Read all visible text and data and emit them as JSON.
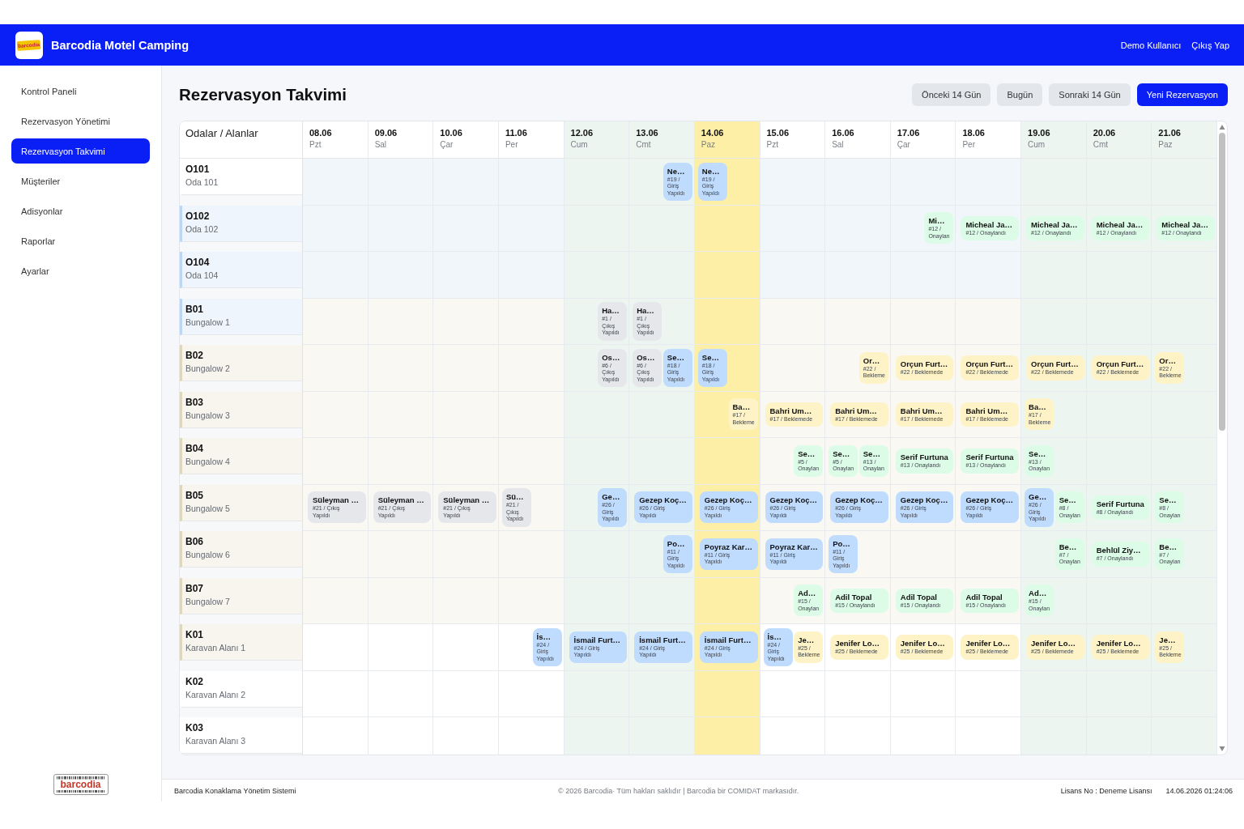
{
  "header": {
    "logo_text": "barcodia",
    "title": "Barcodia Motel Camping",
    "user": "Demo Kullanıcı",
    "logout": "Çıkış Yap"
  },
  "sidebar": {
    "items": [
      {
        "label": "Kontrol Paneli",
        "selected": false
      },
      {
        "label": "Rezervasyon Yönetimi",
        "selected": false
      },
      {
        "label": "Rezervasyon Takvimi",
        "selected": true
      },
      {
        "label": "Müşteriler",
        "selected": false
      },
      {
        "label": "Adisyonlar",
        "selected": false
      },
      {
        "label": "Raporlar",
        "selected": false
      },
      {
        "label": "Ayarlar",
        "selected": false
      }
    ],
    "logo_text": "barcodia"
  },
  "page": {
    "title": "Rezervasyon Takvimi",
    "buttons": [
      {
        "label": "Önceki 14 Gün",
        "kind": "secondary"
      },
      {
        "label": "Bugün",
        "kind": "secondary"
      },
      {
        "label": "Sonraki 14 Gün",
        "kind": "secondary"
      },
      {
        "label": "Yeni Rezervasyon",
        "kind": "primary"
      }
    ]
  },
  "calendar": {
    "corner_label": "Odalar / Alanlar",
    "columns": [
      {
        "date": "08.06",
        "day": "Pzt",
        "kind": "weekday"
      },
      {
        "date": "09.06",
        "day": "Sal",
        "kind": "weekday"
      },
      {
        "date": "10.06",
        "day": "Çar",
        "kind": "weekday"
      },
      {
        "date": "11.06",
        "day": "Per",
        "kind": "weekday"
      },
      {
        "date": "12.06",
        "day": "Cum",
        "kind": "weekend"
      },
      {
        "date": "13.06",
        "day": "Cmt",
        "kind": "weekend"
      },
      {
        "date": "14.06",
        "day": "Paz",
        "kind": "today"
      },
      {
        "date": "15.06",
        "day": "Pzt",
        "kind": "weekday"
      },
      {
        "date": "16.06",
        "day": "Sal",
        "kind": "weekday"
      },
      {
        "date": "17.06",
        "day": "Çar",
        "kind": "weekday"
      },
      {
        "date": "18.06",
        "day": "Per",
        "kind": "weekday"
      },
      {
        "date": "19.06",
        "day": "Cum",
        "kind": "weekend"
      },
      {
        "date": "20.06",
        "day": "Cmt",
        "kind": "weekend"
      },
      {
        "date": "21.06",
        "day": "Paz",
        "kind": "weekend"
      }
    ],
    "rows": [
      {
        "code": "O101",
        "name": "Oda 101",
        "kind": "room",
        "color": "#ffffff",
        "cells": [
          {},
          {},
          {},
          {},
          {},
          {
            "chips": [
              {
                "kind": "arrival",
                "name": "Ne…",
                "info": "#19 / Giriş Yapıldı",
                "color": "#bfdbfe"
              }
            ]
          },
          {
            "chips": [
              {
                "kind": "departure",
                "name": "Ne…",
                "info": "#19 / Giriş Yapıldı",
                "color": "#bfdbfe"
              }
            ]
          },
          {},
          {},
          {},
          {},
          {},
          {},
          {}
        ]
      },
      {
        "code": "O102",
        "name": "Oda 102",
        "kind": "room",
        "color": "#eef5fc",
        "cells": [
          {},
          {},
          {},
          {},
          {},
          {},
          {},
          {},
          {},
          {
            "chips": [
              {
                "kind": "arrival",
                "name": "Mi…",
                "info": "#12 / Onaylan",
                "color": "#dcfce7"
              }
            ]
          },
          {
            "chips": [
              {
                "kind": "stay",
                "name": "Micheal Ja…",
                "info": "#12 / Onaylandı",
                "color": "#dcfce7"
              }
            ]
          },
          {
            "chips": [
              {
                "kind": "stay",
                "name": "Micheal Ja…",
                "info": "#12 / Onaylandı",
                "color": "#dcfce7"
              }
            ]
          },
          {
            "chips": [
              {
                "kind": "stay",
                "name": "Micheal Ja…",
                "info": "#12 / Onaylandı",
                "color": "#dcfce7"
              }
            ]
          },
          {
            "chips": [
              {
                "kind": "stay",
                "name": "Micheal Ja…",
                "info": "#12 / Onaylandı",
                "color": "#dcfce7"
              }
            ]
          }
        ]
      },
      {
        "code": "O104",
        "name": "Oda 104",
        "kind": "room",
        "color": "#eef5fc",
        "cells": [
          {},
          {},
          {},
          {},
          {},
          {},
          {},
          {},
          {},
          {},
          {},
          {},
          {},
          {}
        ]
      },
      {
        "code": "B01",
        "name": "Bungalow 1",
        "kind": "bungalow",
        "color": "#eef5fc",
        "cells": [
          {},
          {},
          {},
          {},
          {
            "chips": [
              {
                "kind": "arrival",
                "name": "Ha…",
                "info": "#1 / Çıkış Yapıldı",
                "color": "#e5e7eb"
              }
            ]
          },
          {
            "chips": [
              {
                "kind": "departure",
                "name": "Ha…",
                "info": "#1 / Çıkış Yapıldı",
                "color": "#e5e7eb"
              }
            ]
          },
          {},
          {},
          {},
          {},
          {},
          {},
          {},
          {}
        ]
      },
      {
        "code": "B02",
        "name": "Bungalow 2",
        "kind": "bungalow",
        "color": "#f7f5ee",
        "cells": [
          {},
          {},
          {},
          {},
          {
            "chips": [
              {
                "kind": "arrival",
                "name": "Os…",
                "info": "#6 / Çıkış Yapıldı",
                "color": "#e5e7eb"
              }
            ]
          },
          {
            "chips": [
              {
                "kind": "departure",
                "name": "Os…",
                "info": "#6 / Çıkış Yapıldı",
                "color": "#e5e7eb"
              },
              {
                "kind": "arrival",
                "name": "Se…",
                "info": "#18 / Giriş Yapıldı",
                "color": "#bfdbfe"
              }
            ]
          },
          {
            "chips": [
              {
                "kind": "departure",
                "name": "Se…",
                "info": "#18 / Giriş Yapıldı",
                "color": "#bfdbfe"
              }
            ]
          },
          {},
          {
            "chips": [
              {
                "kind": "arrival",
                "name": "Or…",
                "info": "#22 / Bekleme",
                "color": "#fef3c7"
              }
            ]
          },
          {
            "chips": [
              {
                "kind": "stay",
                "name": "Orçun Furt…",
                "info": "#22 / Beklemede",
                "color": "#fef3c7"
              }
            ]
          },
          {
            "chips": [
              {
                "kind": "stay",
                "name": "Orçun Furt…",
                "info": "#22 / Beklemede",
                "color": "#fef3c7"
              }
            ]
          },
          {
            "chips": [
              {
                "kind": "stay",
                "name": "Orçun Furt…",
                "info": "#22 / Beklemede",
                "color": "#fef3c7"
              }
            ]
          },
          {
            "chips": [
              {
                "kind": "stay",
                "name": "Orçun Furt…",
                "info": "#22 / Beklemede",
                "color": "#fef3c7"
              }
            ]
          },
          {
            "chips": [
              {
                "kind": "departure",
                "name": "Or…",
                "info": "#22 / Bekleme",
                "color": "#fef3c7"
              }
            ]
          }
        ]
      },
      {
        "code": "B03",
        "name": "Bungalow 3",
        "kind": "bungalow",
        "color": "#f7f5ee",
        "cells": [
          {},
          {},
          {},
          {},
          {},
          {},
          {
            "chips": [
              {
                "kind": "arrival",
                "name": "Ba…",
                "info": "#17 / Bekleme",
                "color": "#fef3c7"
              }
            ]
          },
          {
            "chips": [
              {
                "kind": "stay",
                "name": "Bahri Um…",
                "info": "#17 / Beklemede",
                "color": "#fef3c7"
              }
            ]
          },
          {
            "chips": [
              {
                "kind": "stay",
                "name": "Bahri Um…",
                "info": "#17 / Beklemede",
                "color": "#fef3c7"
              }
            ]
          },
          {
            "chips": [
              {
                "kind": "stay",
                "name": "Bahri Um…",
                "info": "#17 / Beklemede",
                "color": "#fef3c7"
              }
            ]
          },
          {
            "chips": [
              {
                "kind": "stay",
                "name": "Bahri Um…",
                "info": "#17 / Beklemede",
                "color": "#fef3c7"
              }
            ]
          },
          {
            "chips": [
              {
                "kind": "departure",
                "name": "Ba…",
                "info": "#17 / Bekleme",
                "color": "#fef3c7"
              }
            ]
          },
          {},
          {}
        ]
      },
      {
        "code": "B04",
        "name": "Bungalow 4",
        "kind": "bungalow",
        "color": "#f7f5ee",
        "cells": [
          {},
          {},
          {},
          {},
          {},
          {},
          {},
          {
            "chips": [
              {
                "kind": "arrival",
                "name": "Se…",
                "info": "#5 / Onaylan",
                "color": "#dcfce7"
              }
            ]
          },
          {
            "chips": [
              {
                "kind": "departure",
                "name": "Se…",
                "info": "#5 / Onaylan",
                "color": "#dcfce7"
              },
              {
                "kind": "arrival",
                "name": "Se…",
                "info": "#13 / Onaylan",
                "color": "#dcfce7"
              }
            ]
          },
          {
            "chips": [
              {
                "kind": "stay",
                "name": "Serif Furtuna",
                "info": "#13 / Onaylandı",
                "color": "#dcfce7"
              }
            ]
          },
          {
            "chips": [
              {
                "kind": "stay",
                "name": "Serif Furtuna",
                "info": "#13 / Onaylandı",
                "color": "#dcfce7"
              }
            ]
          },
          {
            "chips": [
              {
                "kind": "departure",
                "name": "Se…",
                "info": "#13 / Onaylan",
                "color": "#dcfce7"
              }
            ]
          },
          {},
          {}
        ]
      },
      {
        "code": "B05",
        "name": "Bungalow 5",
        "kind": "bungalow",
        "color": "#f7f5ee",
        "cells": [
          {
            "chips": [
              {
                "kind": "stay",
                "name": "Süleyman …",
                "info": "#21 / Çıkış Yapıldı",
                "color": "#e5e7eb"
              }
            ]
          },
          {
            "chips": [
              {
                "kind": "stay",
                "name": "Süleyman …",
                "info": "#21 / Çıkış Yapıldı",
                "color": "#e5e7eb"
              }
            ]
          },
          {
            "chips": [
              {
                "kind": "stay",
                "name": "Süleyman …",
                "info": "#21 / Çıkış Yapıldı",
                "color": "#e5e7eb"
              }
            ]
          },
          {
            "chips": [
              {
                "kind": "departure",
                "name": "Sü…",
                "info": "#21 / Çıkış Yapıldı",
                "color": "#e5e7eb"
              }
            ]
          },
          {
            "chips": [
              {
                "kind": "arrival",
                "name": "Ge…",
                "info": "#26 / Giriş Yapıldı",
                "color": "#bfdbfe"
              }
            ]
          },
          {
            "chips": [
              {
                "kind": "stay",
                "name": "Gezep Koç…",
                "info": "#26 / Giriş Yapıldı",
                "color": "#bfdbfe"
              }
            ]
          },
          {
            "chips": [
              {
                "kind": "stay",
                "name": "Gezep Koç…",
                "info": "#26 / Giriş Yapıldı",
                "color": "#bfdbfe"
              }
            ]
          },
          {
            "chips": [
              {
                "kind": "stay",
                "name": "Gezep Koç…",
                "info": "#26 / Giriş Yapıldı",
                "color": "#bfdbfe"
              }
            ]
          },
          {
            "chips": [
              {
                "kind": "stay",
                "name": "Gezep Koç…",
                "info": "#26 / Giriş Yapıldı",
                "color": "#bfdbfe"
              }
            ]
          },
          {
            "chips": [
              {
                "kind": "stay",
                "name": "Gezep Koç…",
                "info": "#26 / Giriş Yapıldı",
                "color": "#bfdbfe"
              }
            ]
          },
          {
            "chips": [
              {
                "kind": "stay",
                "name": "Gezep Koç…",
                "info": "#26 / Giriş Yapıldı",
                "color": "#bfdbfe"
              }
            ]
          },
          {
            "chips": [
              {
                "kind": "departure",
                "name": "Ge…",
                "info": "#26 / Giriş Yapıldı",
                "color": "#bfdbfe"
              },
              {
                "kind": "arrival",
                "name": "Se…",
                "info": "#8 / Onaylan",
                "color": "#dcfce7"
              }
            ]
          },
          {
            "chips": [
              {
                "kind": "stay",
                "name": "Serif Furtuna",
                "info": "#8 / Onaylandı",
                "color": "#dcfce7"
              }
            ]
          },
          {
            "chips": [
              {
                "kind": "departure",
                "name": "Se…",
                "info": "#8 / Onaylan",
                "color": "#dcfce7"
              }
            ]
          }
        ]
      },
      {
        "code": "B06",
        "name": "Bungalow 6",
        "kind": "bungalow",
        "color": "#f7f5ee",
        "cells": [
          {},
          {},
          {},
          {},
          {},
          {
            "chips": [
              {
                "kind": "arrival",
                "name": "Po…",
                "info": "#11 / Giriş Yapıldı",
                "color": "#bfdbfe"
              }
            ]
          },
          {
            "chips": [
              {
                "kind": "stay",
                "name": "Poyraz Kar…",
                "info": "#11 / Giriş Yapıldı",
                "color": "#bfdbfe"
              }
            ]
          },
          {
            "chips": [
              {
                "kind": "stay",
                "name": "Poyraz Kar…",
                "info": "#11 / Giriş Yapıldı",
                "color": "#bfdbfe"
              }
            ]
          },
          {
            "chips": [
              {
                "kind": "departure",
                "name": "Po…",
                "info": "#11 / Giriş Yapıldı",
                "color": "#bfdbfe"
              }
            ]
          },
          {},
          {},
          {
            "chips": [
              {
                "kind": "arrival",
                "name": "Be…",
                "info": "#7 / Onaylan",
                "color": "#dcfce7"
              }
            ]
          },
          {
            "chips": [
              {
                "kind": "stay",
                "name": "Behlül Ziy…",
                "info": "#7 / Onaylandı",
                "color": "#dcfce7"
              }
            ]
          },
          {
            "chips": [
              {
                "kind": "departure",
                "name": "Be…",
                "info": "#7 / Onaylan",
                "color": "#dcfce7"
              }
            ]
          }
        ]
      },
      {
        "code": "B07",
        "name": "Bungalow 7",
        "kind": "bungalow",
        "color": "#f7f5ee",
        "cells": [
          {},
          {},
          {},
          {},
          {},
          {},
          {},
          {
            "chips": [
              {
                "kind": "arrival",
                "name": "Ad…",
                "info": "#15 / Onaylan",
                "color": "#dcfce7"
              }
            ]
          },
          {
            "chips": [
              {
                "kind": "stay",
                "name": "Adil Topal",
                "info": "#15 / Onaylandı",
                "color": "#dcfce7"
              }
            ]
          },
          {
            "chips": [
              {
                "kind": "stay",
                "name": "Adil Topal",
                "info": "#15 / Onaylandı",
                "color": "#dcfce7"
              }
            ]
          },
          {
            "chips": [
              {
                "kind": "stay",
                "name": "Adil Topal",
                "info": "#15 / Onaylandı",
                "color": "#dcfce7"
              }
            ]
          },
          {
            "chips": [
              {
                "kind": "departure",
                "name": "Ad…",
                "info": "#15 / Onaylan",
                "color": "#dcfce7"
              }
            ]
          },
          {},
          {}
        ]
      },
      {
        "code": "K01",
        "name": "Karavan Alanı 1",
        "kind": "caravan",
        "color": "#f7f5ee",
        "cells": [
          {},
          {},
          {},
          {
            "chips": [
              {
                "kind": "arrival",
                "name": "İs…",
                "info": "#24 / Giriş Yapıldı",
                "color": "#bfdbfe"
              }
            ]
          },
          {
            "chips": [
              {
                "kind": "stay",
                "name": "İsmail Furt…",
                "info": "#24 / Giriş Yapıldı",
                "color": "#bfdbfe"
              }
            ]
          },
          {
            "chips": [
              {
                "kind": "stay",
                "name": "İsmail Furt…",
                "info": "#24 / Giriş Yapıldı",
                "color": "#bfdbfe"
              }
            ]
          },
          {
            "chips": [
              {
                "kind": "stay",
                "name": "İsmail Furt…",
                "info": "#24 / Giriş Yapıldı",
                "color": "#bfdbfe"
              }
            ]
          },
          {
            "chips": [
              {
                "kind": "departure",
                "name": "İs…",
                "info": "#24 / Giriş Yapıldı",
                "color": "#bfdbfe"
              },
              {
                "kind": "arrival",
                "name": "Je…",
                "info": "#25 / Bekleme",
                "color": "#fef3c7"
              }
            ]
          },
          {
            "chips": [
              {
                "kind": "stay",
                "name": "Jenifer Lo…",
                "info": "#25 / Beklemede",
                "color": "#fef3c7"
              }
            ]
          },
          {
            "chips": [
              {
                "kind": "stay",
                "name": "Jenifer Lo…",
                "info": "#25 / Beklemede",
                "color": "#fef3c7"
              }
            ]
          },
          {
            "chips": [
              {
                "kind": "stay",
                "name": "Jenifer Lo…",
                "info": "#25 / Beklemede",
                "color": "#fef3c7"
              }
            ]
          },
          {
            "chips": [
              {
                "kind": "stay",
                "name": "Jenifer Lo…",
                "info": "#25 / Beklemede",
                "color": "#fef3c7"
              }
            ]
          },
          {
            "chips": [
              {
                "kind": "stay",
                "name": "Jenifer Lo…",
                "info": "#25 / Beklemede",
                "color": "#fef3c7"
              }
            ]
          },
          {
            "chips": [
              {
                "kind": "departure",
                "name": "Je…",
                "info": "#25 / Bekleme",
                "color": "#fef3c7"
              }
            ]
          }
        ]
      },
      {
        "code": "K02",
        "name": "Karavan Alanı 2",
        "kind": "caravan",
        "color": "#ffffff",
        "cells": [
          {},
          {},
          {},
          {},
          {},
          {},
          {},
          {},
          {},
          {},
          {},
          {},
          {},
          {}
        ]
      },
      {
        "code": "K03",
        "name": "Karavan Alanı 3",
        "kind": "caravan",
        "color": "#ffffff",
        "cells": [
          {},
          {},
          {},
          {},
          {},
          {},
          {},
          {},
          {},
          {},
          {},
          {},
          {},
          {}
        ]
      }
    ]
  },
  "footer": {
    "system": "Barcodia Konaklama Yönetim Sistemi",
    "copyright": "© 2026 Barcodia· Tüm hakları saklıdır | Barcodia bir COMIDAT markasıdır.",
    "license": "Lisans No : Deneme Lisansı",
    "timestamp": "14.06.2026 01:24:06"
  }
}
